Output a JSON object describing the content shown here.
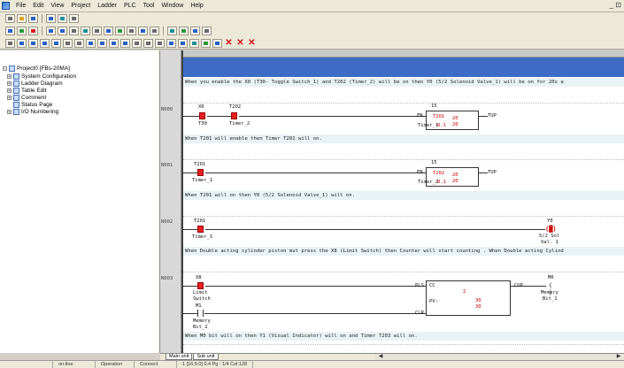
{
  "menu": [
    "File",
    "Edit",
    "View",
    "Project",
    "Ladder",
    "PLC",
    "Tool",
    "Window",
    "Help"
  ],
  "window_controls": "_ ⊡",
  "tree": {
    "root": "Project0 [FBs-20MA]",
    "items": [
      "System Configuration",
      "Ladder Diagram",
      "Table Edit",
      "Comment",
      "Status Page",
      "I/O Numbering"
    ]
  },
  "ladder": {
    "header_comment": "When you enable the X0 (T30- Toggle Switch_1) and T202 (Timer_2) will be on then Y0 (5/2 Solenoid Valve_1) will be on for 20s a",
    "rungs": [
      {
        "number": "N000",
        "contacts": [
          {
            "tag": "X0",
            "name": "T30"
          },
          {
            "tag": "T202",
            "name": "Timer_2"
          }
        ],
        "func": {
          "num": "15",
          "en": "EN",
          "timer": "T201",
          "timer_lbl": "Timer_1",
          "tb": "0.1",
          "preset": "20",
          "preset2": "20",
          "out": "TUP"
        },
        "comment": "When T201 will enable then Timer T202 will on."
      },
      {
        "number": "N001",
        "contacts": [
          {
            "tag": "T201",
            "name": "Timer_1"
          }
        ],
        "func": {
          "num": "15",
          "en": "EN",
          "timer": "T202",
          "timer_lbl": "Timer_2",
          "tb": "0.1",
          "preset": "20",
          "preset2": "20",
          "out": "TUP"
        },
        "comment": "When T201 will on then Y0 (5/2 Solenoid Valve_1) will on."
      },
      {
        "number": "N002",
        "contacts": [
          {
            "tag": "T201",
            "name": "Timer_1"
          }
        ],
        "coil": {
          "tag": "Y0",
          "name1": "5/2 Sol",
          "name2": "Val. 1"
        },
        "comment": "When Double acting cylinder piston mut press the X8 (Limit Switch) then Counter will start counting . When Double acting Cylind"
      },
      {
        "number": "N003",
        "contacts": [
          {
            "tag": "X8",
            "name1": "Limit",
            "name2": "Switch"
          },
          {
            "tag": "M1",
            "name1": "Memory",
            "name2": "Bit_2"
          }
        ],
        "func": {
          "pls": "PLS",
          "clr": "CLR",
          "cnt": "CC",
          "num": "2",
          "pv": "PV:",
          "pv_val": "30",
          "pv_val2": "30",
          "out": "CUP"
        },
        "coil": {
          "tag": "M0",
          "name1": "Memory",
          "name2": "Bit_1"
        },
        "comment": "When M0 bit will on then Y1 (Visual Indicator) will on and Timer T203 will on."
      }
    ]
  },
  "tabs": [
    "Main unit",
    "Sub unit"
  ],
  "status": [
    "",
    "on-line",
    "Operation",
    "Connect",
    "1 [16:5:0] 0.4 Pg : 1/4 Col:128"
  ]
}
